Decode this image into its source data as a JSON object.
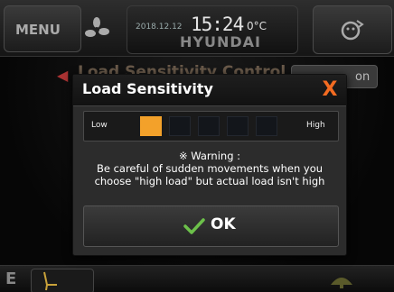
{
  "header": {
    "menu_label": "MENU",
    "date": "2018.12.12",
    "time": "15:24",
    "temperature": "0°C",
    "brand": "HYUNDAI",
    "icons": {
      "fan": "fan-icon",
      "right": "driver-face-icon"
    }
  },
  "background": {
    "title_visible": "Load Sensitivity Control",
    "option_visible": "on"
  },
  "footer": {
    "left_label": "E"
  },
  "dialog": {
    "title": "Load Sensitivity",
    "close_label": "X",
    "slider": {
      "low_label": "Low",
      "high_label": "High",
      "segments": 5,
      "selected": 1
    },
    "warning_title": "※ Warning :",
    "warning_line1": "Be careful of sudden movements when you",
    "warning_line2": "choose \"high load\" but actual load isn't high",
    "ok_label": "OK"
  },
  "colors": {
    "accent": "#f3a12a",
    "close": "#f36b21",
    "ok_check": "#6cc04a"
  }
}
